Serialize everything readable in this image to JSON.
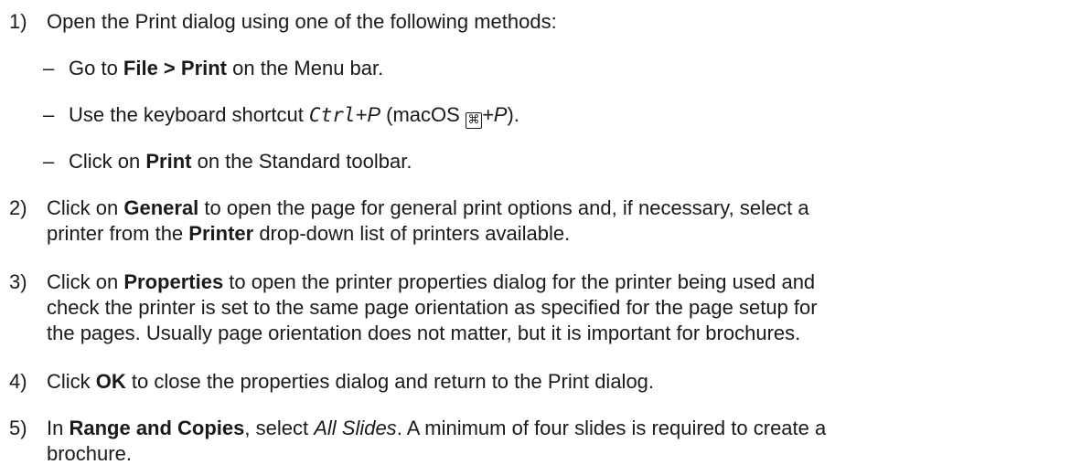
{
  "steps": [
    {
      "num": "1)",
      "text": "Open the Print dialog using one of the following methods:"
    },
    {
      "num": "2)",
      "a": "Click on ",
      "b1": "General",
      "c": " to open the page for general print options and, if necessary, select a",
      "d": "printer from the ",
      "b2": "Printer",
      "e": " drop-down list of printers available."
    },
    {
      "num": "3)",
      "a": "Click on ",
      "b1": "Properties",
      "c": " to open the printer properties dialog for the printer being used and",
      "d": "check the printer is set to the same page orientation as specified for the page setup for",
      "e": "the pages. Usually page orientation does not matter, but it is important for brochures."
    },
    {
      "num": "4)",
      "a": "Click ",
      "b1": "OK",
      "c": " to close the properties dialog and return to the Print dialog."
    },
    {
      "num": "5)",
      "a": "In ",
      "b1": "Range and Copies",
      "c": ", select ",
      "i1": "All Slides",
      "d": ". A minimum of four slides is required to create a",
      "e": "brochure."
    }
  ],
  "methods": [
    {
      "dash": "–",
      "a": "Go to ",
      "b1": "File > Print",
      "c": " on the Menu bar."
    },
    {
      "dash": "–",
      "a": "Use the keyboard shortcut ",
      "m1": "Ctrl",
      "p1": "+P",
      "c": " (macOS ",
      "k1": "⌘",
      "p2": "+P",
      "d": ")."
    },
    {
      "dash": "–",
      "a": "Click on ",
      "b1": "Print",
      "c": " on the Standard toolbar."
    }
  ]
}
